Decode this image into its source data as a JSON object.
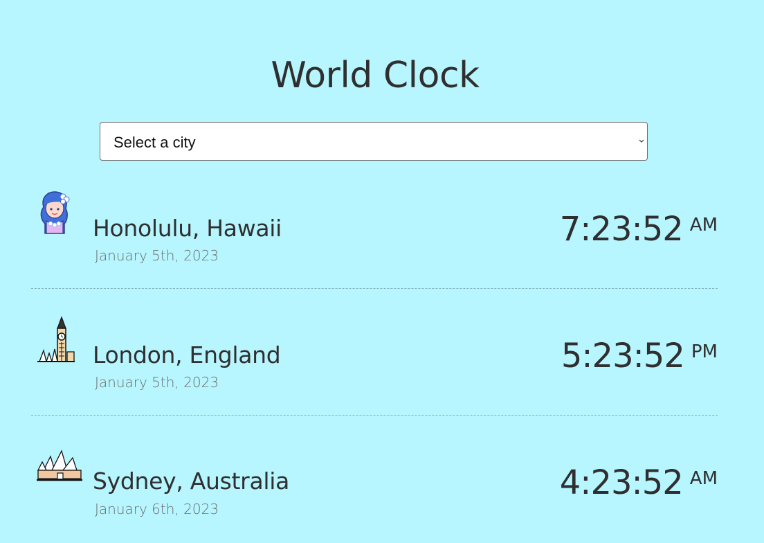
{
  "app": {
    "title": "World Clock"
  },
  "city_select": {
    "selected_label": "Select a city"
  },
  "cities": [
    {
      "icon": "hula-dancer-icon",
      "name": "Honolulu, Hawaii",
      "date": "January 5th, 2023",
      "time": "7:23:52",
      "ampm": "AM"
    },
    {
      "icon": "big-ben-icon",
      "name": "London, England",
      "date": "January 5th, 2023",
      "time": "5:23:52",
      "ampm": "PM"
    },
    {
      "icon": "sydney-opera-house-icon",
      "name": "Sydney, Australia",
      "date": "January 6th, 2023",
      "time": "4:23:52",
      "ampm": "AM"
    }
  ],
  "colors": {
    "background": "#b7f5ff",
    "text": "#2f2f2f",
    "date_text": "#6b6b6b",
    "separator": "#7fb2bb"
  }
}
